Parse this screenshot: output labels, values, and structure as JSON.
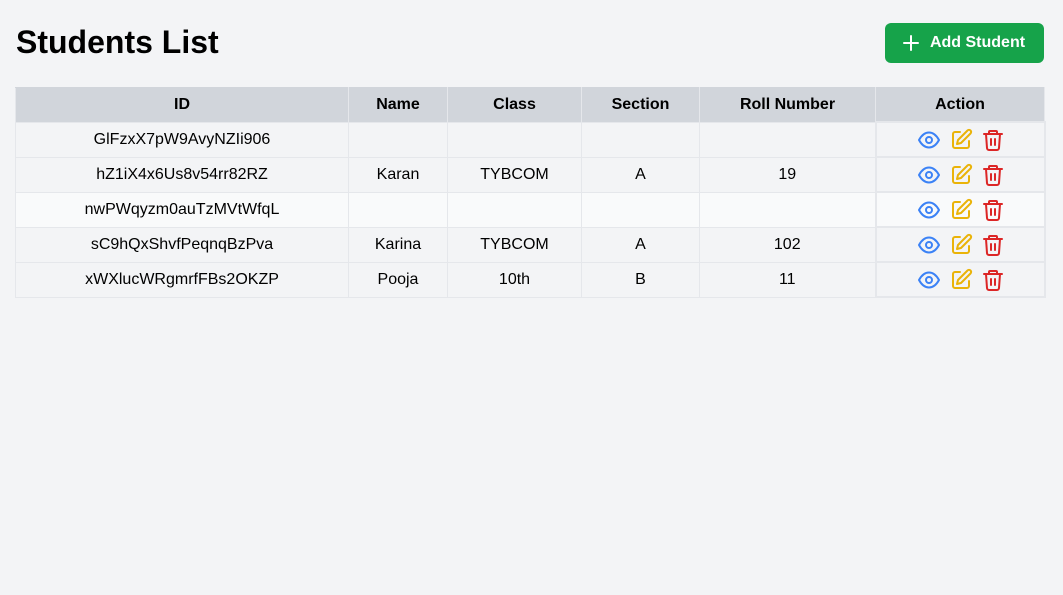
{
  "header": {
    "title": "Students List",
    "add_button_label": "Add Student"
  },
  "table": {
    "columns": [
      "ID",
      "Name",
      "Class",
      "Section",
      "Roll Number",
      "Action"
    ],
    "rows": [
      {
        "id": "GlFzxX7pW9AvyNZIi906",
        "name": "",
        "class": "",
        "section": "",
        "roll": ""
      },
      {
        "id": "hZ1iX4x6Us8v54rr82RZ",
        "name": "Karan",
        "class": "TYBCOM",
        "section": "A",
        "roll": "19"
      },
      {
        "id": "nwPWqyzm0auTzMVtWfqL",
        "name": "",
        "class": "",
        "section": "",
        "roll": ""
      },
      {
        "id": "sC9hQxShvfPeqnqBzPva",
        "name": "Karina",
        "class": "TYBCOM",
        "section": "A",
        "roll": "102"
      },
      {
        "id": "xWXlucWRgmrfFBs2OKZP",
        "name": "Pooja",
        "class": "10th",
        "section": "B",
        "roll": "11"
      }
    ]
  },
  "icons": {
    "add": "plus-icon",
    "view": "eye-icon",
    "edit": "edit-icon",
    "delete": "trash-icon"
  },
  "colors": {
    "primary_button": "#16a34a",
    "view_icon": "#3b82f6",
    "edit_icon": "#eab308",
    "delete_icon": "#dc2626",
    "header_bg": "#d1d5db",
    "page_bg": "#f3f4f6"
  }
}
